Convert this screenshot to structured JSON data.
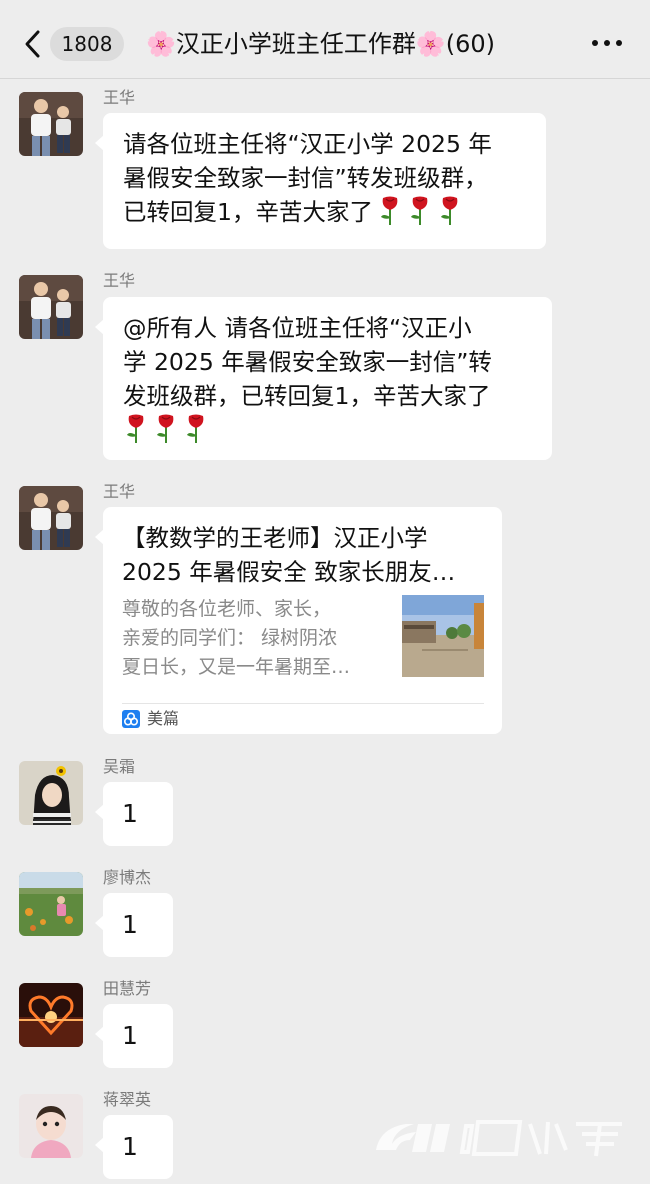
{
  "header": {
    "unread_count": "1808",
    "title": "🌸汉正小学班主任工作群🌸(60)"
  },
  "messages": [
    {
      "sender": "王华",
      "lines": [
        "请各位班主任将“汉正小学 2025 年",
        "暑假安全致家一封信”转发班级群，",
        "已转回复1，辛苦大家了"
      ],
      "emoji": "rose-icon x3"
    },
    {
      "sender": "王华",
      "lines": [
        "@所有人 请各位班主任将“汉正小",
        "学 2025 年暑假安全致家一封信”转",
        "发班级群，已转回复1，辛苦大家了"
      ],
      "emoji": "rose-icon x3"
    },
    {
      "sender": "王华",
      "card": {
        "title_lines": [
          "【教数学的王老师】汉正小学",
          "2025 年暑假安全 致家长朋友…"
        ],
        "desc_lines": [
          "尊敬的各位老师、家长，",
          "亲爱的同学们：  绿树阴浓",
          "夏日长，又是一年暑期至…"
        ],
        "source": "美篇"
      }
    },
    {
      "sender": "吴霜",
      "text": "1"
    },
    {
      "sender": "廖博杰",
      "text": "1"
    },
    {
      "sender": "田慧芳",
      "text": "1"
    },
    {
      "sender": "蒋翠英",
      "text": "1"
    }
  ],
  "colors": {
    "background": "#ededed",
    "bubble": "#ffffff",
    "sender_name": "#7a7a7a",
    "rose": "#d0141f"
  }
}
